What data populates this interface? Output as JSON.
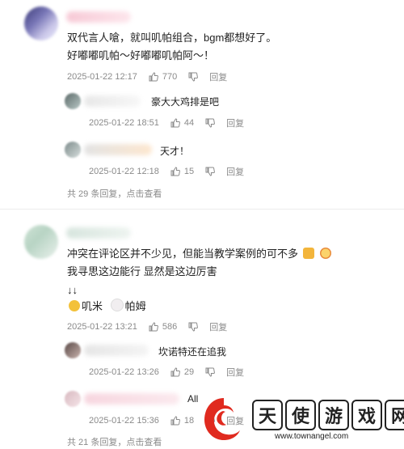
{
  "thread1": {
    "comment_line1": "双代言人嗆，就叫叽帕组合，bgm都想好了。",
    "comment_line2": "好嘟嘟叽帕～好嘟嘟叽帕阿～！",
    "date": "2025-01-22 12:17",
    "likes": "770",
    "reply_label": "回复",
    "replies": [
      {
        "text": "豪大大鸡排是吧",
        "date": "2025-01-22 18:51",
        "likes": "44",
        "reply_label": "回复"
      },
      {
        "text": "天才！",
        "date": "2025-01-22 12:18",
        "likes": "15",
        "reply_label": "回复"
      }
    ],
    "more": "共 29 条回复，点击查看"
  },
  "thread2": {
    "comment_line1": "冲突在评论区并不少见，但能当教学案例的可不多",
    "comment_line2": "我寻思这边能行 显然是这边厉害",
    "comment_line3": "↓↓",
    "tag1": "叽米",
    "tag2": "帕姆",
    "date": "2025-01-22 13:21",
    "likes": "586",
    "reply_label": "回复",
    "replies": [
      {
        "text": "坎诺特还在追我",
        "date": "2025-01-22 13:26",
        "likes": "29",
        "reply_label": "回复"
      },
      {
        "text": "All",
        "date": "2025-01-22 15:36",
        "likes": "18",
        "reply_label": "回复"
      }
    ],
    "more": "共 21 条回复，点击查看"
  },
  "watermark": {
    "chars": [
      "天",
      "使",
      "游",
      "戏",
      "网"
    ],
    "url": "www.townangel.com"
  },
  "colors": {
    "meta_text": "#8a8a8a",
    "logo_red": "#e02a1f",
    "emoji_yellow": "#f3b53b"
  }
}
